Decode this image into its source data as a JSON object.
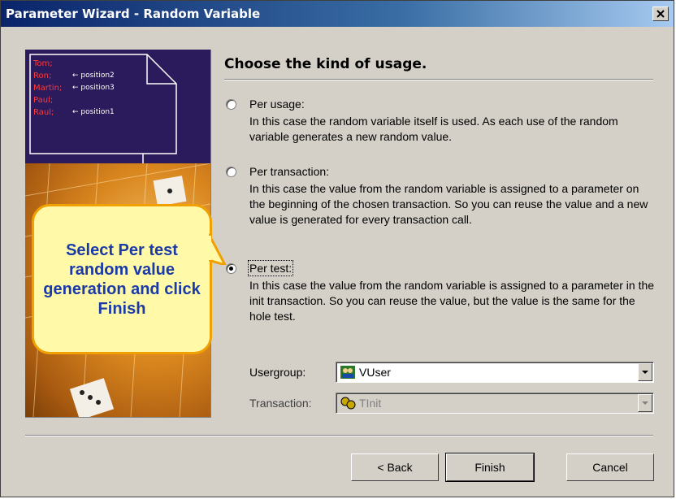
{
  "window": {
    "title": "Parameter Wizard - Random Variable"
  },
  "art": {
    "names": [
      {
        "name": "Tom;",
        "position": ""
      },
      {
        "name": "Ron;",
        "position": "← position2"
      },
      {
        "name": "Martin;",
        "position": "← position3"
      },
      {
        "name": "Paul;",
        "position": ""
      },
      {
        "name": "Raul;",
        "position": "← position1"
      }
    ]
  },
  "callout": {
    "text": "Select Per test random value generation and click Finish"
  },
  "heading": "Choose the kind of usage.",
  "options": [
    {
      "label": "Per usage:",
      "mnemonic_display": "Per usage:",
      "selected": false,
      "description": "In this case the random variable itself is used. As each use of the random variable generates a new random value."
    },
    {
      "label": "Per transaction:",
      "selected": false,
      "description": "In this case the value from the random variable is assigned to a parameter on the beginning of the chosen transaction. So you can reuse the value and a new value is generated for every transaction call."
    },
    {
      "label": "Per test:",
      "selected": true,
      "description": "In this case the value from the random variable is assigned to a parameter in the init transaction. So you can reuse the value, but the value is the same for the hole test."
    }
  ],
  "fields": {
    "usergroup": {
      "label": "Usergroup:",
      "value": "VUser",
      "icon": "usergroup-icon"
    },
    "transaction": {
      "label": "Transaction:",
      "value": "TInit",
      "icon": "transaction-icon",
      "disabled": true
    }
  },
  "buttons": {
    "back": "< Back",
    "finish": "Finish",
    "cancel": "Cancel"
  },
  "colors": {
    "titlebar": "#0a246a",
    "callout_fill": "#fff9a8",
    "callout_border": "#f0a000",
    "callout_text": "#1a3aa8"
  }
}
